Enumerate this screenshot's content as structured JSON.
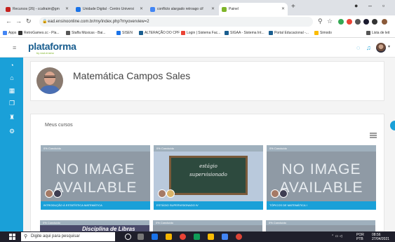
{
  "browser": {
    "tabs": [
      {
        "label": "Recursos (26) - ccafraim@gm",
        "color": "#c5221f"
      },
      {
        "label": "Unidade Digital · Centro Universi",
        "color": "#1a73e8"
      },
      {
        "label": "conflicto alargado retroago cif",
        "color": "#4285f4"
      },
      {
        "label": "Painel",
        "color": "#7fb52a"
      }
    ],
    "url": "ead.ensinoonline.com.br/my/index.php?myoverview=2",
    "bookmarks": [
      {
        "label": "Apps",
        "color": "#4285f4"
      },
      {
        "label": "RetroGames.cc - Pla...",
        "color": "#333333"
      },
      {
        "label": "Staffa Músicas - Bai...",
        "color": "#555555"
      },
      {
        "label": "SISEN",
        "color": "#1a73e8"
      },
      {
        "label": "ALTERAÇÃO DO CPF",
        "color": "#1a5e8f"
      },
      {
        "label": "Login | Sistema Fac...",
        "color": "#ea4335"
      },
      {
        "label": "SIGAA - Sistema Int...",
        "color": "#1a5e8f"
      },
      {
        "label": "Portal Educacional -...",
        "color": "#1a5e8f"
      },
      {
        "label": "Simodo",
        "color": "#fbbc04"
      },
      {
        "label": "Lista de leit",
        "color": "#555555"
      }
    ]
  },
  "app": {
    "logo": "plataforma",
    "logo_sub": "by ead.ensino"
  },
  "page": {
    "title": "Matemática Campos Sales",
    "my_courses_label": "Meus cursos"
  },
  "courses": [
    {
      "band": "0% Concluído",
      "name": "INTRODUÇÃO À ESTATÍSTICA MATEMÁTICA",
      "image_text_1": "NO IMAGE",
      "image_text_2": "AVAILABLE"
    },
    {
      "band": "0% Concluído",
      "name": "ESTÁGIO SUPERVISIONADO IV",
      "board_line_1": "estágio",
      "board_line_2": "supervisionado"
    },
    {
      "band": "0% Concluído",
      "name": "TÓPICOS DE MATEMÁTICA I",
      "image_text_1": "NO IMAGE",
      "image_text_2": "AVAILABLE"
    }
  ],
  "courses_row2": [
    {
      "band": "0% Concluído",
      "banner": "Disciplina de Libras"
    },
    {
      "band": "0% Concluído"
    },
    {
      "band": "0% Concluído"
    }
  ],
  "taskbar": {
    "search_placeholder": "Digite aqui para pesquisar",
    "lang": "POR",
    "lang_sub": "PTB",
    "time": "08:56",
    "date": "27/04/2021"
  }
}
